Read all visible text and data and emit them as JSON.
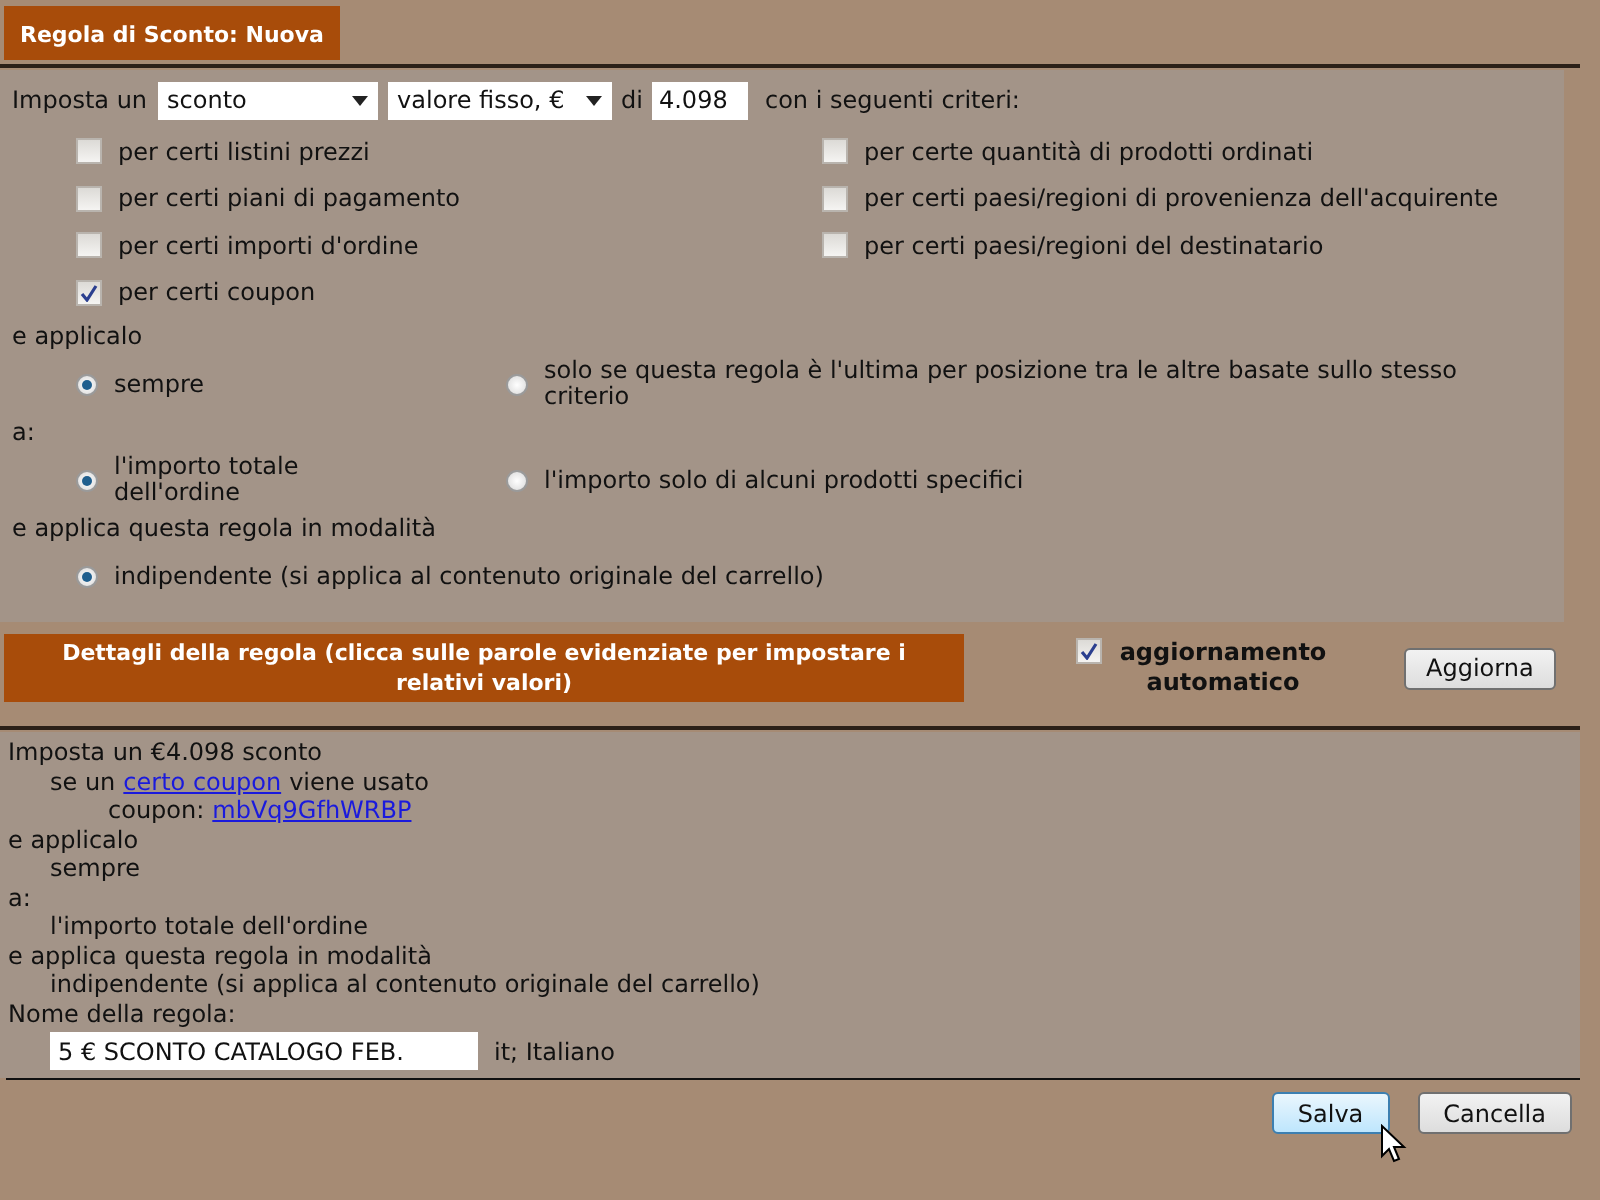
{
  "title": "Regola di Sconto: Nuova",
  "setup": {
    "prefix": "Imposta un",
    "type_select": "sconto",
    "value_select": "valore fisso, €",
    "of": "di",
    "amount": "4.098",
    "suffix": "con i seguenti criteri:"
  },
  "criteria_columns": [
    [
      {
        "label": "per certi listini prezzi",
        "checked": false
      },
      {
        "label": "per certi piani di pagamento",
        "checked": false
      },
      {
        "label": "per certi importi d'ordine",
        "checked": false
      },
      {
        "label": "per certi coupon",
        "checked": true
      }
    ],
    [
      {
        "label": "per certe quantità di prodotti ordinati",
        "checked": false
      },
      {
        "label": "per certi paesi/regioni di provenienza dell'acquirente",
        "checked": false
      },
      {
        "label": "per certi paesi/regioni del destinatario",
        "checked": false
      }
    ]
  ],
  "groups": [
    {
      "label": "e applicalo",
      "options": [
        {
          "label": "sempre",
          "selected": true
        },
        {
          "label": "solo se questa regola è l'ultima per posizione tra le altre basate sullo stesso criterio",
          "selected": false
        }
      ]
    },
    {
      "label": "a:",
      "options": [
        {
          "label": "l'importo totale dell'ordine",
          "selected": true
        },
        {
          "label": "l'importo solo di alcuni prodotti specifici",
          "selected": false
        }
      ]
    },
    {
      "label": "e applica questa regola in modalità",
      "options": [
        {
          "label": "indipendente (si applica al contenuto originale del carrello)",
          "selected": true
        }
      ]
    }
  ],
  "details_bar": {
    "title": "Dettagli della regola (clicca sulle parole evidenziate per impostare i relativi valori)",
    "auto_update": {
      "label": "aggiornamento automatico",
      "checked": true
    },
    "refresh_button": "Aggiorna"
  },
  "summary": [
    {
      "parts": [
        {
          "kind": "text",
          "text": "Imposta un €4.098 sconto"
        }
      ],
      "children": [
        {
          "parts": [
            {
              "kind": "text",
              "text": "se un"
            },
            {
              "kind": "link",
              "text": "certo coupon"
            },
            {
              "kind": "text",
              "text": "viene usato"
            }
          ],
          "children": [
            {
              "parts": [
                {
                  "kind": "text",
                  "text": "coupon:"
                },
                {
                  "kind": "link",
                  "text": "mbVq9GfhWRBP"
                }
              ]
            }
          ]
        }
      ]
    },
    {
      "parts": [
        {
          "kind": "text",
          "text": "e applicalo"
        }
      ],
      "children": [
        {
          "parts": [
            {
              "kind": "text",
              "text": "sempre"
            }
          ]
        }
      ]
    },
    {
      "parts": [
        {
          "kind": "text",
          "text": "a:"
        }
      ],
      "children": [
        {
          "parts": [
            {
              "kind": "text",
              "text": "l'importo totale dell'ordine"
            }
          ]
        }
      ]
    },
    {
      "parts": [
        {
          "kind": "text",
          "text": "e applica questa regola in modalità"
        }
      ],
      "children": [
        {
          "parts": [
            {
              "kind": "text",
              "text": "indipendente (si applica al contenuto originale del carrello)"
            }
          ]
        }
      ]
    }
  ],
  "rule_name": {
    "label": "Nome della regola:",
    "value": "5 € SCONTO CATALOGO FEB.",
    "language": "it; Italiano"
  },
  "buttons": [
    {
      "label": "Salva",
      "hovered": true
    },
    {
      "label": "Cancella",
      "hovered": false
    }
  ]
}
